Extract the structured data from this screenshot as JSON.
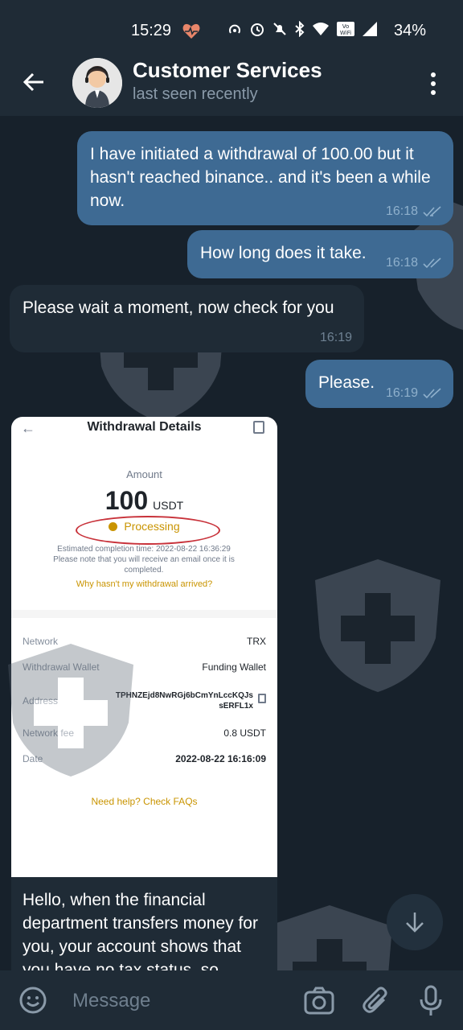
{
  "status_bar": {
    "time": "15:29",
    "battery": "34%"
  },
  "header": {
    "title": "Customer Services",
    "subtitle": "last seen recently"
  },
  "messages": [
    {
      "dir": "out",
      "text": "I have initiated a withdrawal of 100.00 but it hasn't reached binance.. and it's been a while now.",
      "time": "16:18"
    },
    {
      "dir": "out",
      "text": "How long does it take.",
      "time": "16:18"
    },
    {
      "dir": "in",
      "text": "Please wait a moment, now check for you",
      "time": "16:19"
    },
    {
      "dir": "out",
      "text": "Please.",
      "time": "16:19"
    }
  ],
  "withdrawal": {
    "title": "Withdrawal Details",
    "amount_label": "Amount",
    "amount": "100",
    "currency": "USDT",
    "status": "Processing",
    "estimated": "Estimated completion time: 2022-08-22 16:36:29",
    "note": "Please note that you will receive an email once it is completed.",
    "why_link": "Why hasn't my withdrawal arrived?",
    "rows": [
      {
        "key": "Network",
        "value": "TRX"
      },
      {
        "key": "Withdrawal Wallet",
        "value": "Funding Wallet"
      },
      {
        "key": "Address",
        "value": "TPHNZEjd8NwRGj6bCmYnLccKQJs sERFL1x"
      },
      {
        "key": "Network fee",
        "value": "0.8 USDT"
      },
      {
        "key": "Date",
        "value": "2022-08-22 16:16:09"
      }
    ],
    "help_link": "Need help? Check FAQs"
  },
  "incoming_text": "Hello, when the financial department transfers money for you, your account shows that you have no tax status, so",
  "input": {
    "placeholder": "Message"
  },
  "colors": {
    "bg": "#17212b",
    "bar": "#1f2b36",
    "outgoing": "#3e6a93",
    "accent": "#c99400"
  }
}
